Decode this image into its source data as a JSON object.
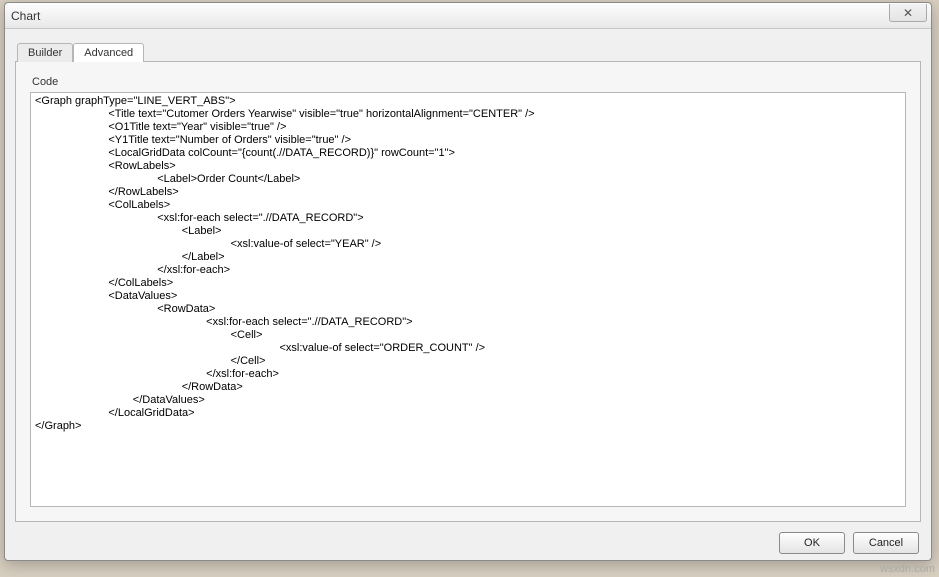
{
  "dialog": {
    "title": "Chart",
    "close_glyph": "✕"
  },
  "tabs": {
    "builder": "Builder",
    "advanced": "Advanced"
  },
  "panel": {
    "code_label": "Code",
    "code_value": "<Graph graphType=\"LINE_VERT_ABS\">\n                        <Title text=\"Cutomer Orders Yearwise\" visible=\"true\" horizontalAlignment=\"CENTER\" />\n                        <O1Title text=\"Year\" visible=\"true\" />\n                        <Y1Title text=\"Number of Orders\" visible=\"true\" />\n                        <LocalGridData colCount=\"{count(.//DATA_RECORD)}\" rowCount=\"1\">\n                        <RowLabels>\n                                        <Label>Order Count</Label>\n                        </RowLabels>\n                        <ColLabels>\n                                        <xsl:for-each select=\".//DATA_RECORD\">\n                                                <Label>\n                                                                <xsl:value-of select=\"YEAR\" />\n                                                </Label>\n                                        </xsl:for-each>\n                        </ColLabels>\n                        <DataValues>\n                                        <RowData>\n                                                        <xsl:for-each select=\".//DATA_RECORD\">\n                                                                <Cell>\n                                                                                <xsl:value-of select=\"ORDER_COUNT\" />\n                                                                </Cell>\n                                                        </xsl:for-each>\n                                                </RowData>\n                                </DataValues>\n                        </LocalGridData>\n</Graph>"
  },
  "buttons": {
    "ok": "OK",
    "cancel": "Cancel"
  },
  "watermark": "wsxdn.com"
}
